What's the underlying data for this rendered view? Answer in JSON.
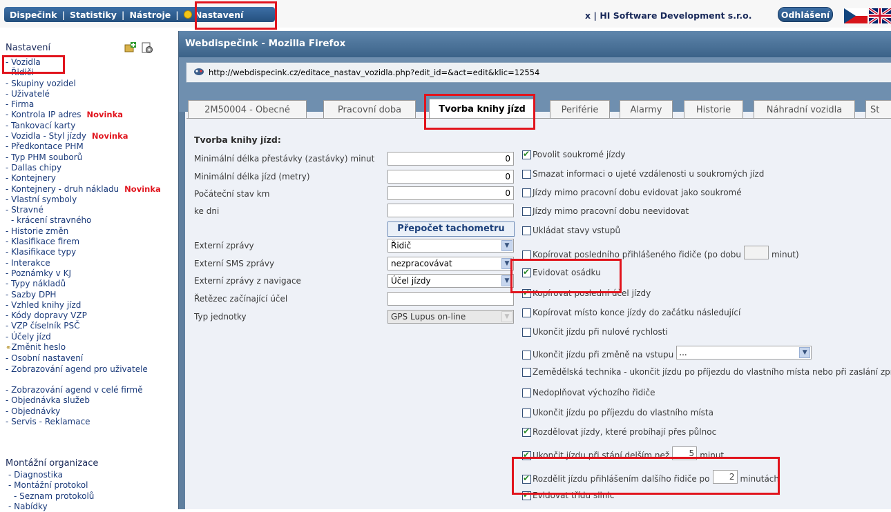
{
  "topmenu": {
    "items": [
      "Dispečink",
      "Statistiky",
      "Nástroje",
      "Nastavení"
    ],
    "separator": "|",
    "company": "x | HI Software Development s.r.o.",
    "logout": "Odhlášení"
  },
  "sidebar": {
    "title": "Nastavení",
    "items": [
      "- Vozidla",
      "- Řidiči",
      "- Skupiny vozidel",
      "- Uživatelé",
      "- Firma",
      "- Kontrola IP adres",
      "- Tankovací karty",
      "- Vozidla - Styl jízdy",
      "- Předkontace PHM",
      "- Typ PHM souborů",
      "- Dallas chipy",
      "- Kontejnery",
      "- Kontejnery - druh nákladu",
      "- Vlastní symboly",
      "- Stravné",
      "- krácení stravného",
      "- Historie změn",
      "- Klasifikace firem",
      "- Klasifikace typy",
      "- Interakce",
      "- Poznámky v KJ",
      "- Typy nákladů",
      "- Sazby DPH",
      "- Vzhled knihy jízd",
      "- Kódy dopravy VZP",
      "- VZP číselník PSČ",
      "- Účely jízd",
      "Změnit heslo",
      "- Osobní nastavení",
      "- Zobrazování agend pro uživatele",
      "- Zobrazování agend v celé firmě",
      "- Objednávka služeb",
      "- Objednávky",
      "- Servis - Reklamace"
    ],
    "novinka": "Novinka",
    "section2_title": "Montážní organizace",
    "section2_items": [
      "- Diagnostika",
      "- Montážní protokol",
      "- Seznam protokolů",
      "- Nabídky"
    ]
  },
  "window": {
    "title": "Webdispečink - Mozilla Firefox",
    "url": "http://webdispecink.cz/editace_nastav_vozidla.php?edit_id=&act=edit&klic=12554"
  },
  "tabs": [
    "2M50004 - Obecné",
    "Pracovní doba",
    "Tvorba knihy jízd",
    "Periférie",
    "Alarmy",
    "Historie",
    "Náhradní vozidla",
    "St"
  ],
  "form": {
    "section_title": "Tvorba knihy jízd:",
    "fields": [
      {
        "label": "Minimální délka přestávky (zastávky) minut",
        "value": "0"
      },
      {
        "label": "Minimální délka jízd (metry)",
        "value": "0"
      },
      {
        "label": "Počáteční stav km",
        "value": "0"
      },
      {
        "label": "ke dni",
        "value": ""
      }
    ],
    "tacho_button": "Přepočet tachometru",
    "selects": [
      {
        "label": "Externí zprávy",
        "value": "Řidič"
      },
      {
        "label": "Externí SMS zprávy",
        "value": "nezpracovávat"
      },
      {
        "label": "Externí zprávy z navigace",
        "value": "Účel jízdy"
      },
      {
        "label": "Řetězec začínající účel",
        "value": ""
      },
      {
        "label": "Typ jednotky",
        "value": "GPS Lupus on-line"
      }
    ],
    "checks": [
      {
        "text": "Povolit soukromé jízdy",
        "checked": true
      },
      {
        "text": "Smazat informaci o ujeté vzdálenosti u soukromých jízd",
        "checked": false
      },
      {
        "text": "Jízdy mimo pracovní dobu evidovat jako soukromé",
        "checked": false
      },
      {
        "text": "Jízdy mimo pracovní dobu neevidovat",
        "checked": false
      },
      {
        "text": "Ukládat stavy vstupů",
        "checked": false
      },
      {
        "text": "Kopírovat posledního přihlášeného řidiče (po dobu",
        "checked": false,
        "suffix": "minut)"
      },
      {
        "text": "Evidovat osádku",
        "checked": true
      },
      {
        "text": "Kopírovat poslední účel jízdy",
        "checked": true
      },
      {
        "text": "Kopírovat místo konce jízdy do začátku následující",
        "checked": false
      },
      {
        "text": "Ukončit jízdu při nulové rychlosti",
        "checked": false
      },
      {
        "text": "Ukončit jízdu při změně na vstupu",
        "checked": false,
        "select": "..."
      },
      {
        "text": "Zemědělská technika - ukončit jízdu po příjezdu do vlastního místa nebo při zaslání zpráv",
        "checked": false
      },
      {
        "text": "Nedoplňovat výchozího řidiče",
        "checked": false
      },
      {
        "text": "Ukončit jízdu po příjezdu do vlastního místa",
        "checked": false
      },
      {
        "text": "Rozdělovat jízdy, které probíhají přes půlnoc",
        "checked": true
      },
      {
        "text": "Ukončit jízdu při stání delším než",
        "checked": true,
        "value": "5",
        "suffix": "minut"
      },
      {
        "text": "Rozdělit jízdu přihlášením dalšího řidiče po",
        "checked": true,
        "value": "2",
        "suffix": "minutách"
      },
      {
        "text": "Evidovat třídu silnic",
        "checked": true
      }
    ]
  }
}
